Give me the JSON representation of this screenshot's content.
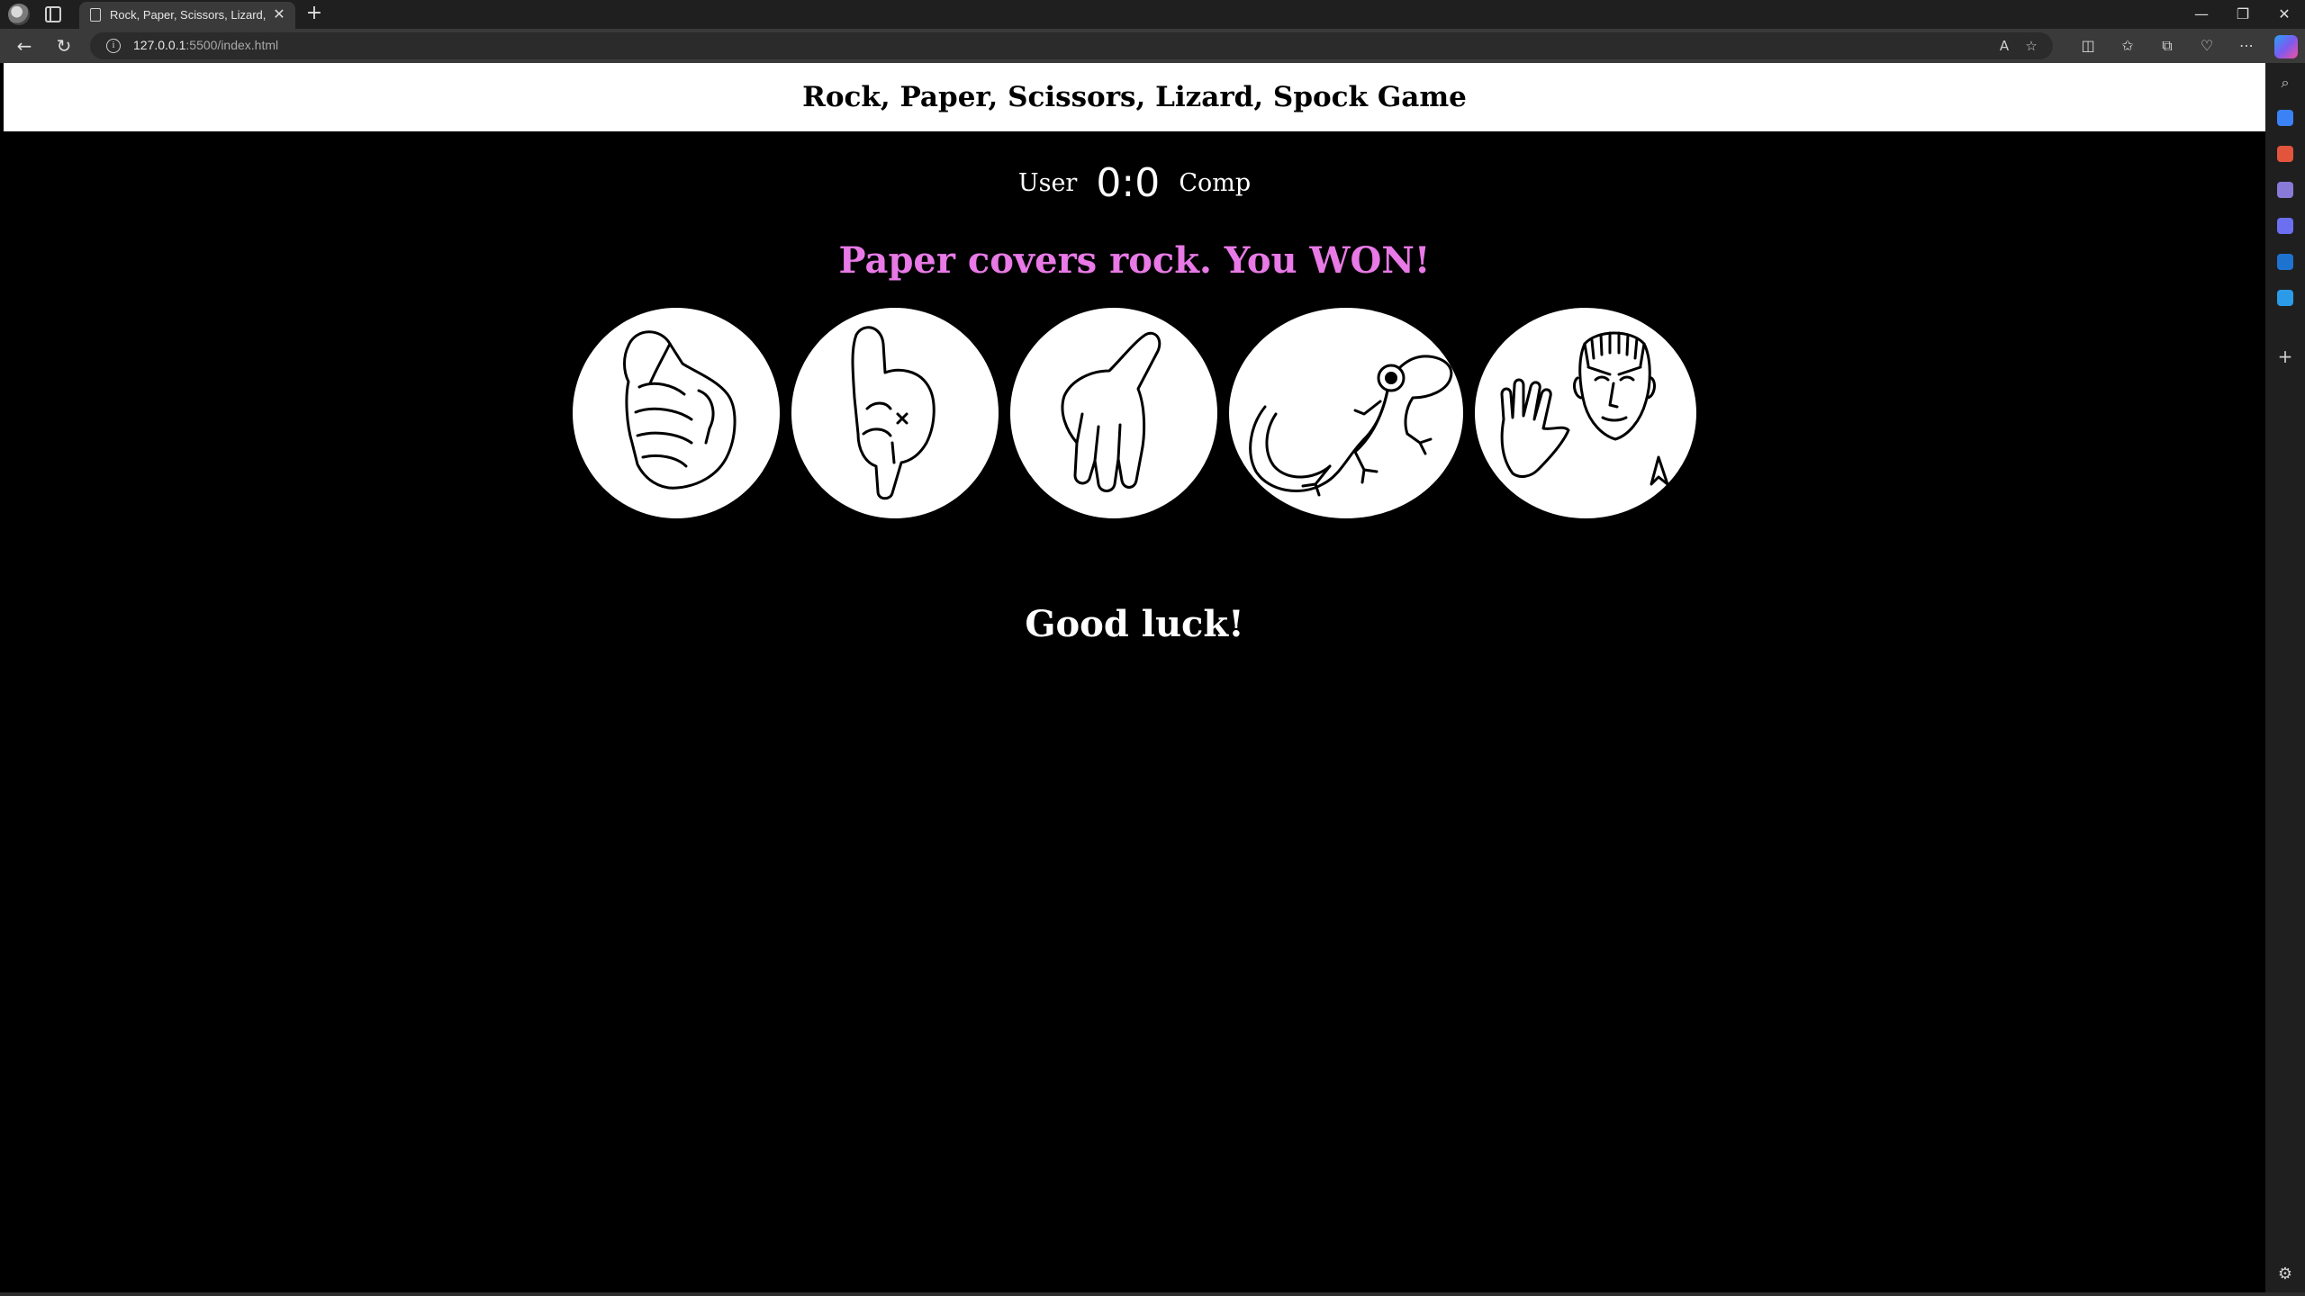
{
  "browser": {
    "tab_title": "Rock, Paper, Scissors, Lizard, Spock Game",
    "url_host": "127.0.0.1",
    "url_rest": ":5500/index.html",
    "new_tab_symbol": "+",
    "close_symbol": "✕"
  },
  "game": {
    "title": "Rock, Paper, Scissors, Lizard, Spock Game",
    "user_label": "User",
    "comp_label": "Comp",
    "user_score": "0",
    "score_separator": ":",
    "comp_score": "0",
    "result_text": "Paper covers rock. You WON!",
    "result_color": "#e879e6",
    "message": "Good luck!",
    "choices": [
      {
        "id": "rock",
        "icon": "fist-icon"
      },
      {
        "id": "paper",
        "icon": "pointing-hand-icon"
      },
      {
        "id": "scissors",
        "icon": "flat-hand-icon"
      },
      {
        "id": "lizard",
        "icon": "lizard-icon"
      },
      {
        "id": "spock",
        "icon": "spock-icon"
      }
    ]
  }
}
